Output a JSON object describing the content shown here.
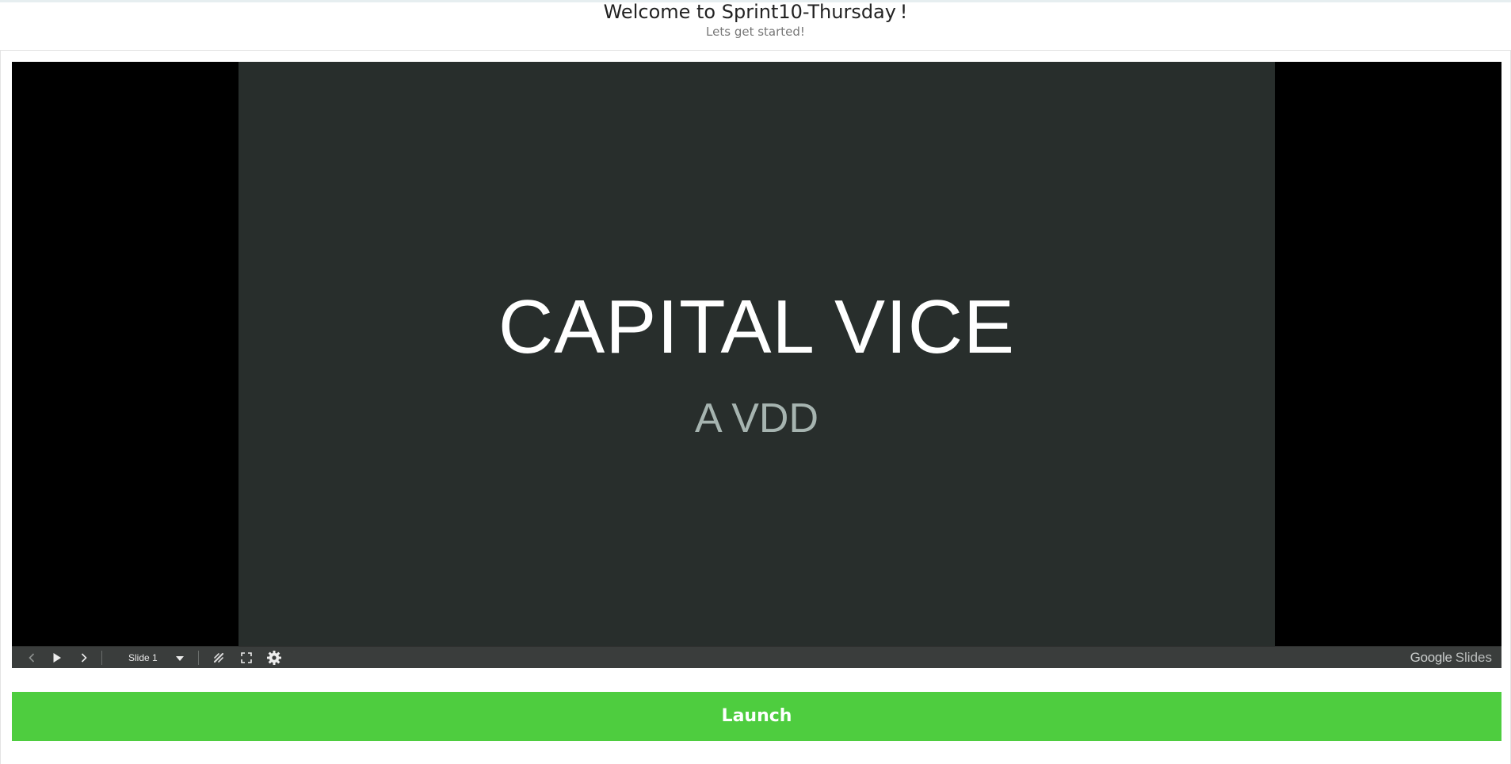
{
  "header": {
    "title": "Welcome to Sprint10-Thursday !",
    "subtitle": "Lets get started!"
  },
  "slide": {
    "title": "CAPITAL VICE",
    "subtitle": "A VDD"
  },
  "player": {
    "current_slide_label": "Slide 1",
    "brand_google": "Google",
    "brand_slides": "Slides",
    "icons": [
      "chevron-left-icon",
      "play-icon",
      "chevron-right-icon",
      "caret-down-icon",
      "pointer-icon",
      "fullscreen-icon",
      "gear-icon"
    ]
  },
  "launch": {
    "label": "Launch"
  },
  "colors": {
    "launch_green": "#4ecd3f",
    "slide_bg": "#282e2c",
    "controls_bg": "#3a3d3c",
    "subtitle_gray": "#a6b4b0"
  }
}
